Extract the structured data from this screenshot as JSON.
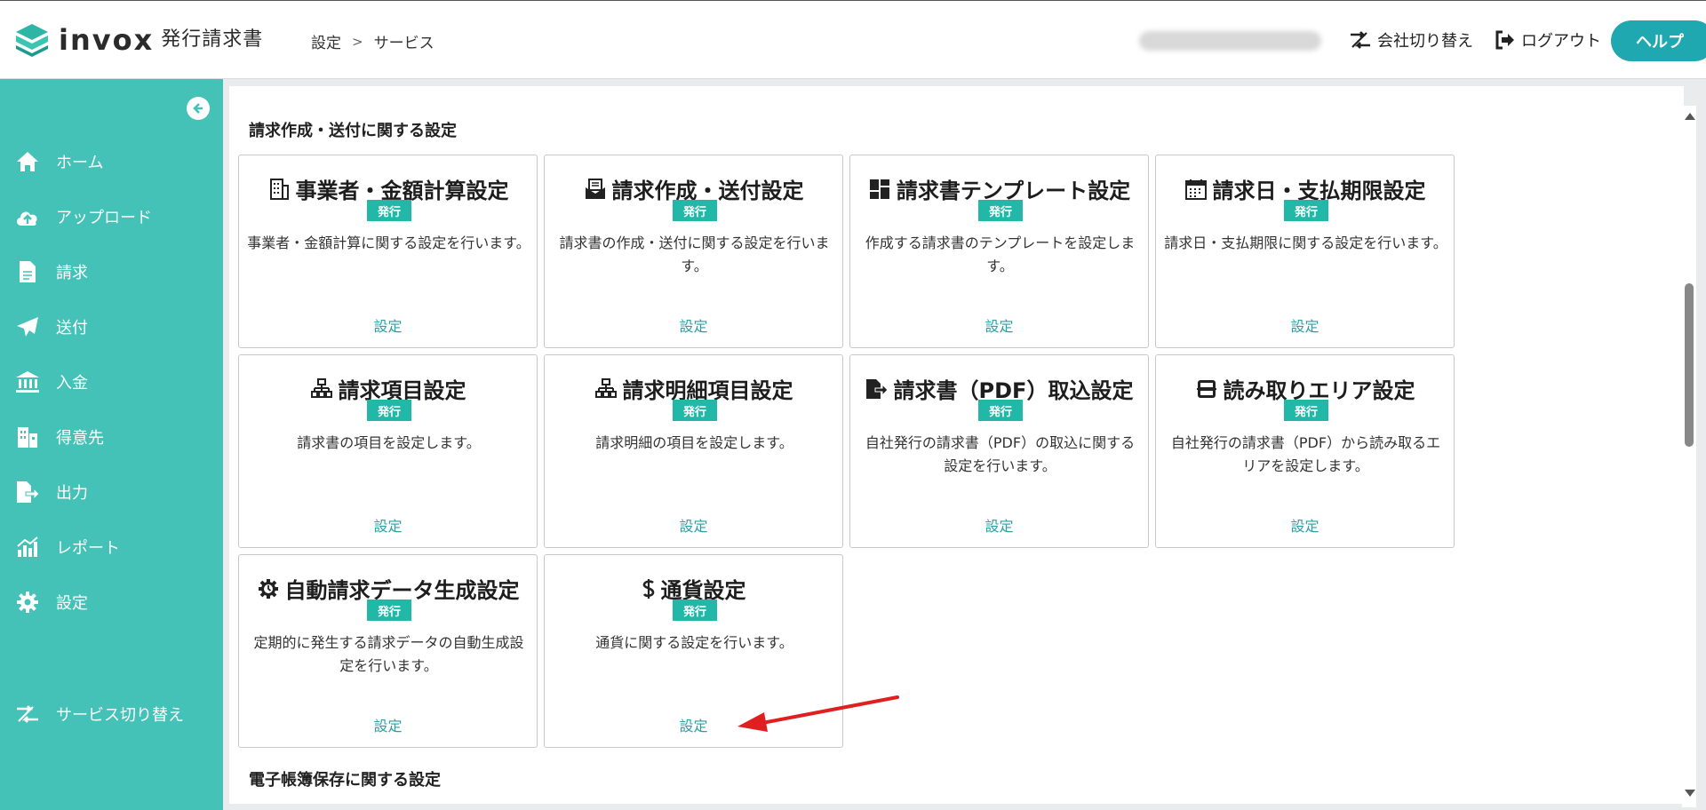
{
  "header": {
    "logo_word": "invox",
    "logo_sub": "発行請求書",
    "breadcrumb": [
      "設定",
      "サービス"
    ],
    "company_switch": "会社切り替え",
    "logout": "ログアウト",
    "help": "ヘルプ"
  },
  "sidebar": {
    "items": [
      {
        "label": "ホーム",
        "icon": "home-icon"
      },
      {
        "label": "アップロード",
        "icon": "cloud-upload-icon"
      },
      {
        "label": "請求",
        "icon": "document-icon"
      },
      {
        "label": "送付",
        "icon": "paper-plane-icon"
      },
      {
        "label": "入金",
        "icon": "bank-icon"
      },
      {
        "label": "得意先",
        "icon": "building-icon"
      },
      {
        "label": "出力",
        "icon": "file-export-icon"
      },
      {
        "label": "レポート",
        "icon": "chart-icon"
      },
      {
        "label": "設定",
        "icon": "gear-icon"
      }
    ],
    "service_switch": "サービス切り替え"
  },
  "main": {
    "section1_title": "請求作成・送付に関する設定",
    "section2_title": "電子帳簿保存に関する設定",
    "badge": "発行",
    "cards": [
      {
        "title": "事業者・金額計算設定",
        "icon": "building-icon",
        "desc": "事業者・金額計算に関する設定を行います。",
        "link": "設定"
      },
      {
        "title": "請求作成・送付設定",
        "icon": "envelope-icon",
        "desc": "請求書の作成・送付に関する設定を行います。",
        "link": "設定"
      },
      {
        "title": "請求書テンプレート設定",
        "icon": "dashboard-icon",
        "desc": "作成する請求書のテンプレートを設定します。",
        "link": "設定"
      },
      {
        "title": "請求日・支払期限設定",
        "icon": "calendar-icon",
        "desc": "請求日・支払期限に関する設定を行います。",
        "link": "設定"
      },
      {
        "title": "請求項目設定",
        "icon": "sitemap-icon",
        "desc": "請求書の項目を設定します。",
        "link": "設定"
      },
      {
        "title": "請求明細項目設定",
        "icon": "sitemap-icon",
        "desc": "請求明細の項目を設定します。",
        "link": "設定"
      },
      {
        "title": "請求書（PDF）取込設定",
        "icon": "file-import-icon",
        "desc": "自社発行の請求書（PDF）の取込に関する設定を行います。",
        "link": "設定"
      },
      {
        "title": "読み取りエリア設定",
        "icon": "scan-icon",
        "desc": "自社発行の請求書（PDF）から読み取るエリアを設定します。",
        "link": "設定"
      },
      {
        "title": "自動請求データ生成設定",
        "icon": "auto-gear-icon",
        "desc": "定期的に発生する請求データの自動生成設定を行います。",
        "link": "設定"
      },
      {
        "title": "通貨設定",
        "icon": "dollar-icon",
        "desc": "通貨に関する設定を行います。",
        "link": "設定"
      }
    ]
  },
  "colors": {
    "sidebar": "#44c2b7",
    "accent": "#22b8a8",
    "help": "#1fa8b0",
    "link": "#2a9fa6",
    "annotation_arrow": "#e02020"
  }
}
